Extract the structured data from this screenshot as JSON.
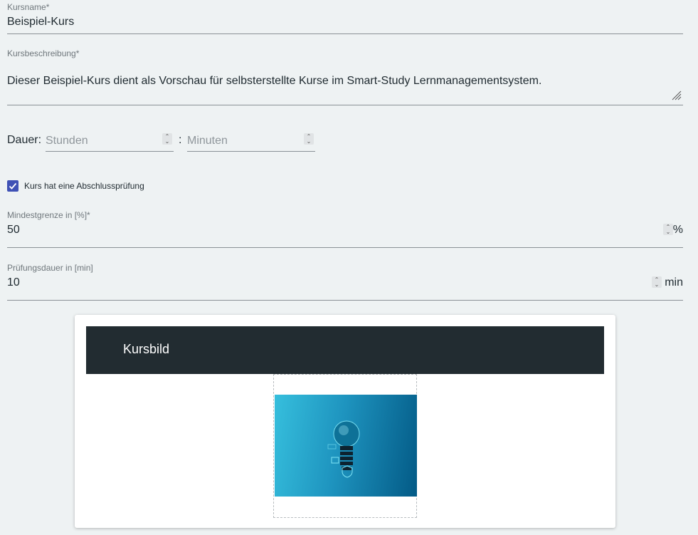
{
  "course_name": {
    "label": "Kursname*",
    "value": "Beispiel-Kurs"
  },
  "course_description": {
    "label": "Kursbeschreibung*",
    "value": "Dieser Beispiel-Kurs dient als Vorschau für selbsterstellte Kurse im Smart-Study Lernmanagementsystem."
  },
  "duration": {
    "label": "Dauer:",
    "separator": ":",
    "hours_placeholder": "Stunden",
    "minutes_placeholder": "Minuten"
  },
  "final_exam": {
    "checked": true,
    "label": "Kurs hat eine Abschlussprüfung"
  },
  "min_threshold": {
    "label": "Mindestgrenze in [%]*",
    "value": "50",
    "unit": "%"
  },
  "exam_duration": {
    "label": "Prüfungsdauer in [min]",
    "value": "10",
    "unit": "min"
  },
  "course_image": {
    "header": "Kursbild"
  },
  "colors": {
    "background": "#eef2f3",
    "checkbox": "#3f51b5",
    "card_header": "#222c31",
    "image_light": "#2fb6d6",
    "image_dark": "#045a85"
  }
}
